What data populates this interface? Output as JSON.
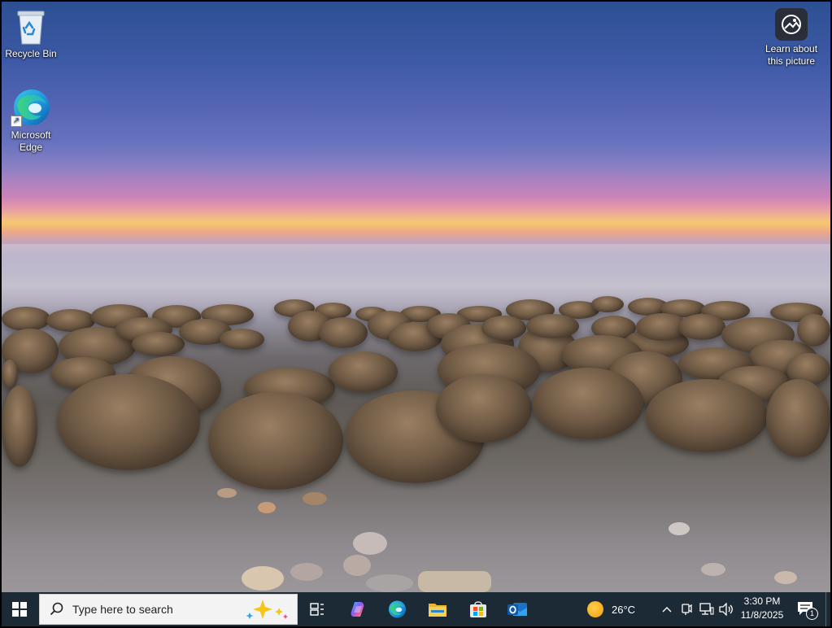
{
  "desktop": {
    "icons": [
      {
        "label": "Recycle Bin"
      },
      {
        "label": "Microsoft Edge"
      },
      {
        "label": "Learn about this picture"
      }
    ]
  },
  "taskbar": {
    "search_placeholder": "Type here to search",
    "pinned": [
      {
        "name": "task-view"
      },
      {
        "name": "copilot"
      },
      {
        "name": "edge"
      },
      {
        "name": "file-explorer"
      },
      {
        "name": "microsoft-store"
      },
      {
        "name": "outlook"
      }
    ],
    "weather": {
      "temp": "26°C"
    },
    "clock": {
      "time": "3:30 PM",
      "date": "11/8/2025"
    },
    "notifications": {
      "count": "1"
    }
  },
  "colors": {
    "taskbar_bg": "#1c2a36",
    "accent": "#0078d4"
  }
}
